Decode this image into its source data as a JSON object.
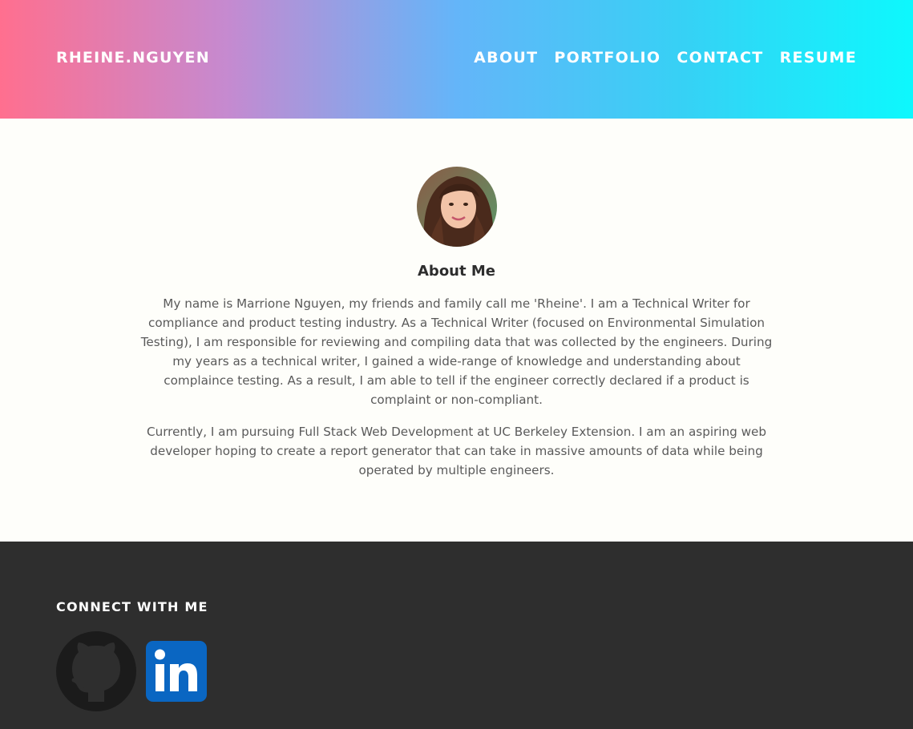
{
  "header": {
    "brand": "RHEINE.NGUYEN",
    "nav": [
      "ABOUT",
      "PORTFOLIO",
      "CONTACT",
      "RESUME"
    ]
  },
  "main": {
    "title": "About Me",
    "paragraphs": [
      "My name is Marrione Nguyen, my friends and family call me 'Rheine'. I am a Technical Writer for compliance and product testing industry. As a Technical Writer (focused on Environmental Simulation Testing), I am responsible for reviewing and compiling data that was collected by the engineers. During my years as a technical writer, I gained a wide-range of knowledge and understanding about complaince testing. As a result, I am able to tell if the engineer correctly declared if a product is complaint or non-compliant.",
      "Currently, I am pursuing Full Stack Web Development at UC Berkeley Extension. I am an aspiring web developer hoping to create a report generator that can take in massive amounts of data while being operated by multiple engineers."
    ]
  },
  "footer": {
    "title": "CONNECT WITH ME",
    "icons": [
      "github-icon",
      "linkedin-icon"
    ]
  },
  "colors": {
    "gradient": [
      "#ff6f8f",
      "#c58ad0",
      "#64b5f9",
      "#36d1f5",
      "#0df8fd"
    ],
    "footer_bg": "#2e2e2e",
    "page_bg": "#fefefa",
    "linkedin_blue": "#0a66c2"
  }
}
